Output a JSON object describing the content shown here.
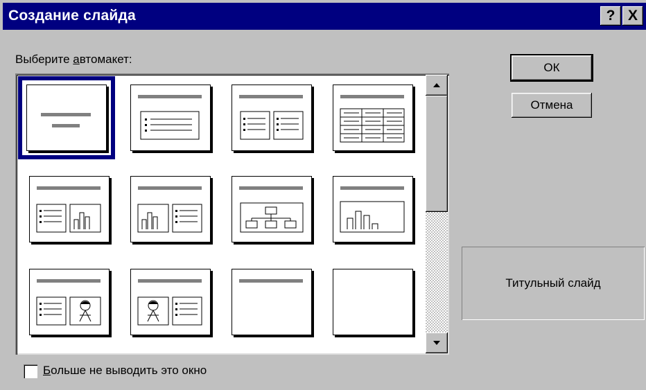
{
  "dialog": {
    "title": "Создание слайда",
    "help_label": "?",
    "close_label": "X"
  },
  "layout_picker": {
    "label_prefix": "Выберите ",
    "label_accel": "а",
    "label_rest": "втомакет:",
    "selected_index": 0,
    "layouts": [
      {
        "icon": "title-slide-icon"
      },
      {
        "icon": "bulleted-list-icon"
      },
      {
        "icon": "two-column-text-icon"
      },
      {
        "icon": "table-icon"
      },
      {
        "icon": "text-and-chart-icon"
      },
      {
        "icon": "chart-and-text-icon"
      },
      {
        "icon": "organization-chart-icon"
      },
      {
        "icon": "chart-icon"
      },
      {
        "icon": "text-and-clip-art-icon"
      },
      {
        "icon": "clip-art-and-text-icon"
      },
      {
        "icon": "title-only-icon"
      },
      {
        "icon": "blank-icon"
      }
    ]
  },
  "buttons": {
    "ok": "ОК",
    "cancel": "Отмена"
  },
  "preview": {
    "layout_name": "Титульный слайд"
  },
  "dont_show": {
    "accel": "Б",
    "rest": "ольше не выводить это окно",
    "checked": false
  }
}
